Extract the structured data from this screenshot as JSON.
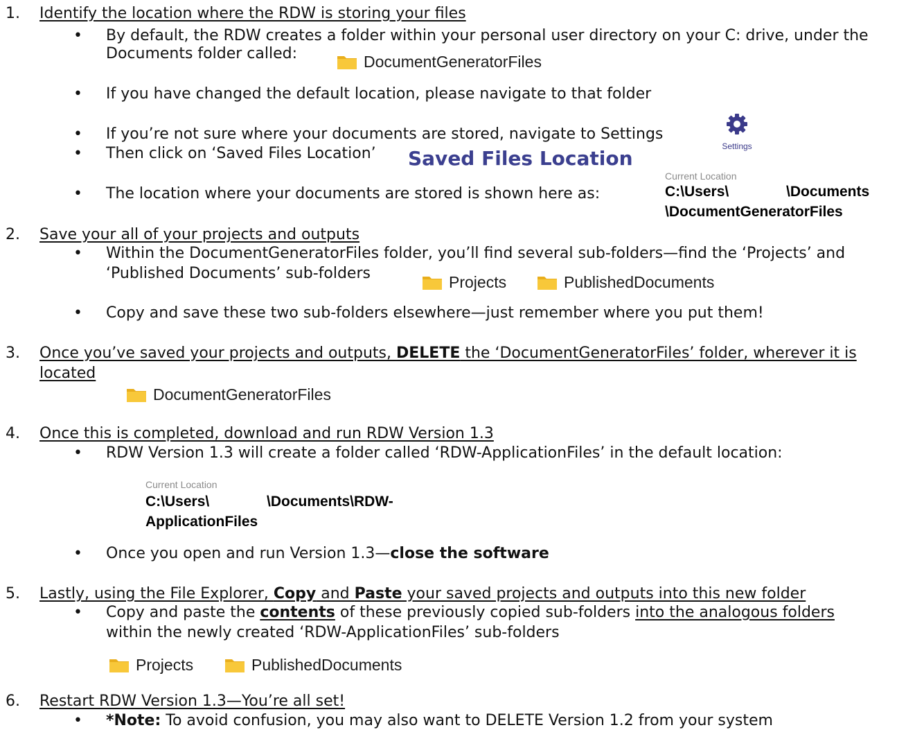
{
  "steps": [
    {
      "num": "1.",
      "heading": "Identify the location where the RDW is storing your files"
    },
    {
      "num": "2.",
      "heading": "Save your all of your projects and outputs"
    },
    {
      "num": "3.",
      "heading_pre": "Once you’ve saved your projects and outputs, ",
      "heading_bold": "DELETE",
      "heading_post": " the ‘DocumentGeneratorFiles’ folder, wherever it is",
      "heading_line2": "located"
    },
    {
      "num": "4.",
      "heading": "Once this is completed, download and run RDW Version 1.3"
    },
    {
      "num": "5.",
      "heading_pre": "Lastly, using the File Explorer, ",
      "heading_bold1": "Copy",
      "heading_mid": " and ",
      "heading_bold2": "Paste",
      "heading_post": " your saved projects and outputs into this new folder"
    },
    {
      "num": "6.",
      "heading": "Restart RDW Version 1.3—You’re all set!"
    }
  ],
  "bullets": {
    "b1a_line1": "By default, the RDW creates a folder within your personal user directory on your C: drive, under the",
    "b1a_line2": "Documents folder called:",
    "b1b": "If you have changed the default location, please navigate to that folder",
    "b1c": "If you’re not sure where your documents are stored, navigate to Settings",
    "b1d": "Then click on ‘Saved Files Location’",
    "b1e": "The location where your documents are stored is shown here as:",
    "b2a_line1": "Within the DocumentGeneratorFiles folder, you’ll find several sub-folders—find the ‘Projects’ and",
    "b2a_line2": "‘Published Documents’ sub-folders",
    "b2b": "Copy and save these two sub-folders elsewhere—just remember where you put them!",
    "b4a": "RDW Version 1.3 will create a folder called ‘RDW-ApplicationFiles’ in the default location:",
    "b4b_pre": "Once you open and run Version 1.3—",
    "b4b_bold": "close the software",
    "b5a_pre": "Copy and paste the ",
    "b5a_bold": "contents",
    "b5a_mid": " of these previously copied sub-folders ",
    "b5a_u": "into the analogous folders",
    "b5a_line2": "within the newly created ‘RDW-ApplicationFiles’ sub-folders",
    "b6a_bold": "*Note:",
    "b6a_rest": " To avoid confusion, you may also want to DELETE Version 1.2 from your system"
  },
  "bullet_char": "•",
  "images": {
    "folder_docgen": "DocumentGeneratorFiles",
    "settings_label": "Settings",
    "saved_files_location": "Saved Files Location",
    "current_location": "Current Location",
    "path1_line1_a": "C:\\Users\\",
    "path1_line1_b": "\\Documents",
    "path1_line2": "\\DocumentGeneratorFiles",
    "folder_projects": "Projects",
    "folder_published": "PublishedDocuments",
    "path2_line1_a": "C:\\Users\\",
    "path2_line1_b": "\\Documents\\RDW-",
    "path2_line2": "ApplicationFiles"
  },
  "colors": {
    "folder_yellow": "#f8c83a",
    "folder_tab": "#e9ae1c",
    "gear_purple": "#3b3a8a",
    "saved_files_blue": "#3b3f8f"
  },
  "icons": [
    "folder-icon",
    "gear-icon"
  ]
}
